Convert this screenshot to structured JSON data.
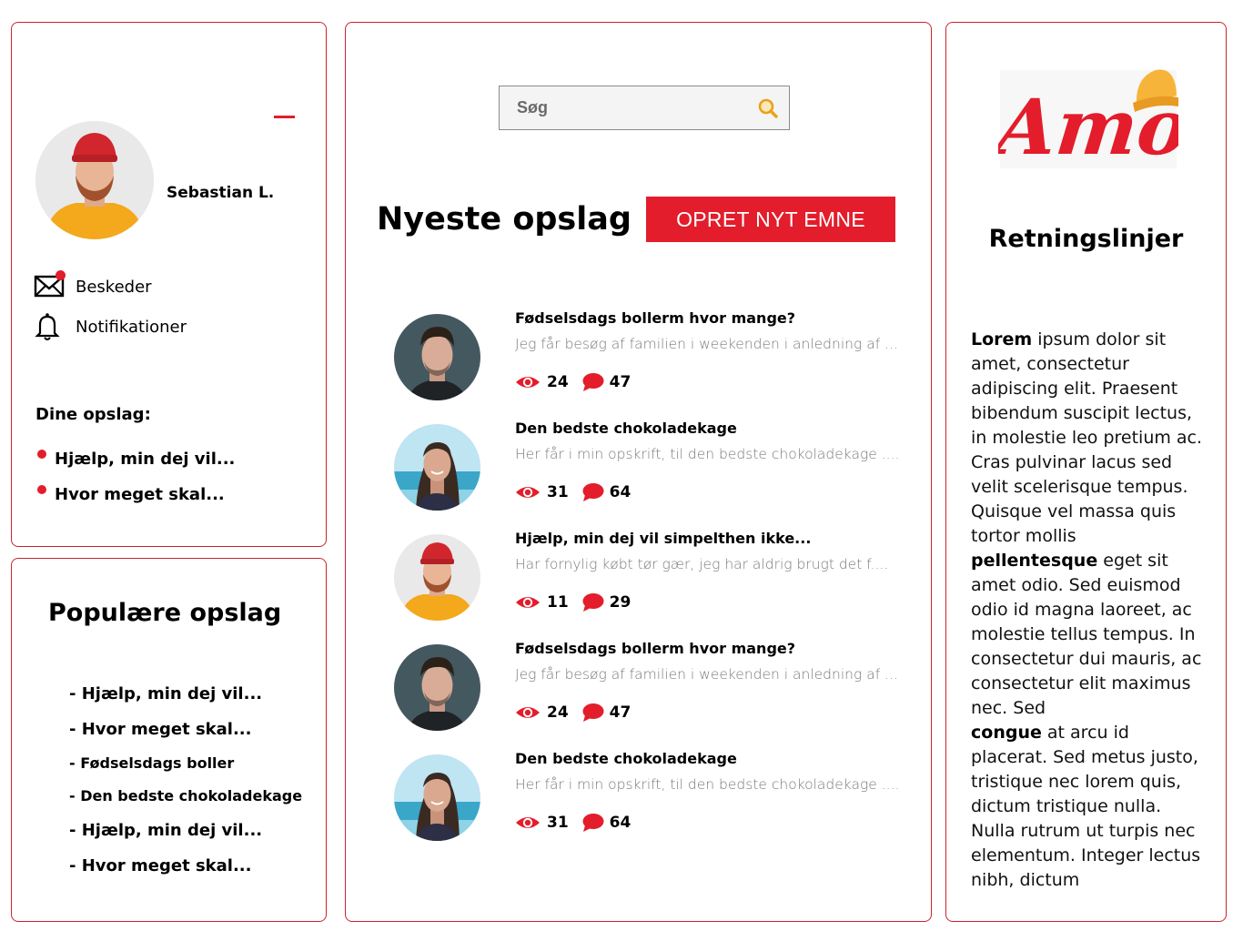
{
  "profile": {
    "user_name": "Sebastian L.",
    "nav": [
      {
        "label": "Beskeder",
        "icon": "mail-icon",
        "has_badge": true
      },
      {
        "label": "Notifikationer",
        "icon": "bell-icon",
        "has_badge": false
      }
    ],
    "my_posts_title": "Dine opslag:",
    "my_posts": [
      "Hjælp, min dej vil...",
      "Hvor meget skal..."
    ]
  },
  "popular": {
    "title": "Populære opslag",
    "items": [
      "- Hjælp, min dej vil...",
      "- Hvor meget skal...",
      "- Fødselsdags boller",
      "- Den bedste chokoladekage",
      "- Hjælp, min dej vil...",
      "- Hvor meget skal..."
    ]
  },
  "feed": {
    "search_placeholder": "Søg",
    "title": "Nyeste opslag",
    "create_button": "OPRET NYT EMNE",
    "posts": [
      {
        "title": "Fødselsdags bollerm hvor mange?",
        "excerpt": "Jeg får besøg af familien i weekenden i anledning af ...",
        "views": "24",
        "comments": "47",
        "avatar": "man-portrait"
      },
      {
        "title": "Den bedste chokoladekage",
        "excerpt": "Her får i min opskrift, til den bedste chokoladekage ....",
        "views": "31",
        "comments": "64",
        "avatar": "woman-portrait"
      },
      {
        "title": "Hjælp, min dej vil simpelthen ikke...",
        "excerpt": "Har fornylig købt tør gær, jeg har aldrig brugt det f....",
        "views": "11",
        "comments": "29",
        "avatar": "beanie-man-portrait"
      },
      {
        "title": "Fødselsdags bollerm hvor mange?",
        "excerpt": "Jeg får besøg af familien i weekenden i anledning af ...",
        "views": "24",
        "comments": "47",
        "avatar": "man-portrait"
      },
      {
        "title": "Den bedste chokoladekage",
        "excerpt": "Her får i min opskrift, til den bedste chokoladekage ....",
        "views": "31",
        "comments": "64",
        "avatar": "woman-portrait"
      }
    ]
  },
  "guidelines": {
    "logo_text": "Amo",
    "title": "Retningslinjer",
    "paragraphs": [
      {
        "lead": "Lorem",
        "text": " ipsum dolor sit amet, consectetur adipiscing elit. Praesent bibendum suscipit lectus, in molestie leo pretium ac. Cras pulvinar lacus sed velit scelerisque tempus. Quisque vel massa quis tortor mollis"
      },
      {
        "lead": "pellentesque",
        "text": " eget sit amet odio. Sed euismod odio id magna laoreet, ac molestie tellus tempus. In consectetur dui mauris, ac consectetur elit maximus nec. Sed"
      },
      {
        "lead": "congue",
        "text": " at arcu id placerat. Sed metus justo, tristique nec lorem quis, dictum tristique nulla. Nulla rutrum ut turpis nec elementum. Integer lectus nibh, dictum"
      }
    ]
  },
  "colors": {
    "accent": "#e31d2b",
    "border": "#c8232f",
    "logo_hat": "#f6b53a",
    "sweater": "#f4a81c"
  }
}
